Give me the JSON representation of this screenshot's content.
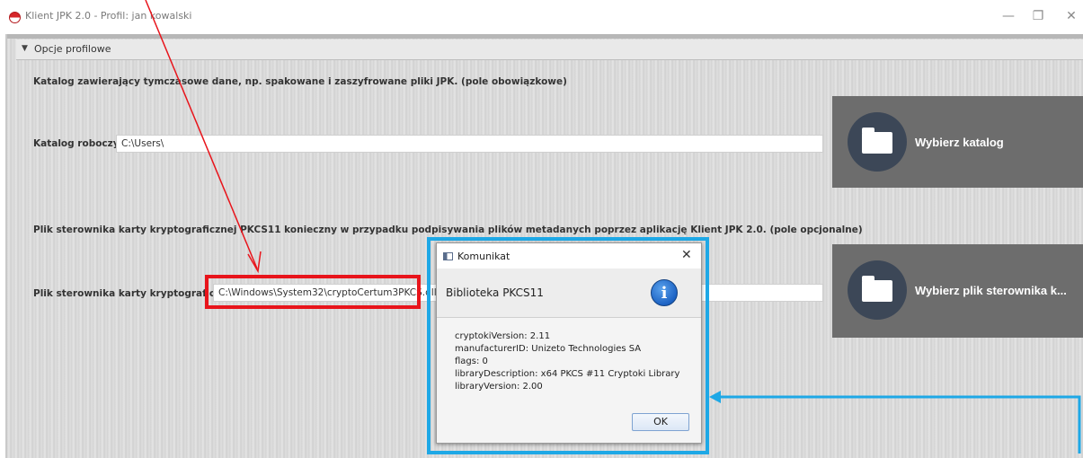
{
  "window": {
    "title": "Klient JPK 2.0 - Profil: jan kowalski",
    "minimize_glyph": "—",
    "maximize_glyph": "❐",
    "close_glyph": "✕"
  },
  "section": {
    "arrow": "▼",
    "title": "Opcje profilowe"
  },
  "temp_dir": {
    "description": "Katalog zawierający tymczasowe dane, np. spakowane i zaszyfrowane pliki JPK. (pole obowiązkowe)",
    "label": "Katalog roboczy",
    "value": "C:\\Users\\",
    "button_label": "Wybierz katalog"
  },
  "pkcs11": {
    "description": "Plik sterownika karty kryptograficznej PKCS11 konieczny w przypadku podpisywania plików metadanych poprzez aplikację Klient JPK 2.0. (pole opcjonalne)",
    "label": "Plik sterownika karty kryptograficznej",
    "value": "C:\\Windows\\System32\\cryptoCertum3PKCS.dll",
    "button_label": "Wybierz plik sterownika k..."
  },
  "dialog": {
    "title": "Komunikat",
    "close_glyph": "✕",
    "header": "Biblioteka PKCS11",
    "info_glyph": "i",
    "lines": [
      "cryptokiVersion: 2.11",
      "manufacturerID: Unizeto Technologies SA",
      "flags: 0",
      "libraryDescription: x64 PKCS #11 Cryptoki Library",
      "libraryVersion: 2.00"
    ],
    "ok_label": "OK"
  },
  "colors": {
    "annotation_red": "#e8141b",
    "annotation_blue": "#1ea8e6",
    "button_bg": "#6d6d6d",
    "button_circle": "#3c4757"
  },
  "icons": {
    "app": "app-logo-icon",
    "folder": "folder-icon",
    "info": "info-icon",
    "dialog": "window-icon"
  }
}
